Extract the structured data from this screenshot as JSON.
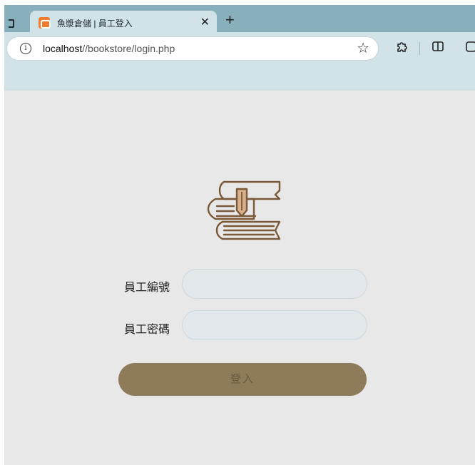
{
  "browser": {
    "tab": {
      "title": "魚漿倉儲 | 員工登入",
      "close": "✕"
    },
    "new_tab": "+",
    "address": {
      "host": "localhost",
      "path": "//bookstore/login.php"
    }
  },
  "login": {
    "employee_id_label": "員工編號",
    "employee_id_value": "",
    "password_label": "員工密碼",
    "password_value": "",
    "submit_label": "登入"
  },
  "colors": {
    "tabstrip": "#87b0bc",
    "toolbar": "#d2e3e8",
    "page_background": "#e8e8e8",
    "button": "#8d7b5a",
    "logo_stroke": "#7a5a38",
    "logo_bookmark": "#d9b08c"
  },
  "icons": [
    "window-icon",
    "favicon",
    "close-icon",
    "new-tab-icon",
    "info-icon",
    "star-icon",
    "extensions-icon",
    "split-screen-icon",
    "books-logo-icon"
  ]
}
